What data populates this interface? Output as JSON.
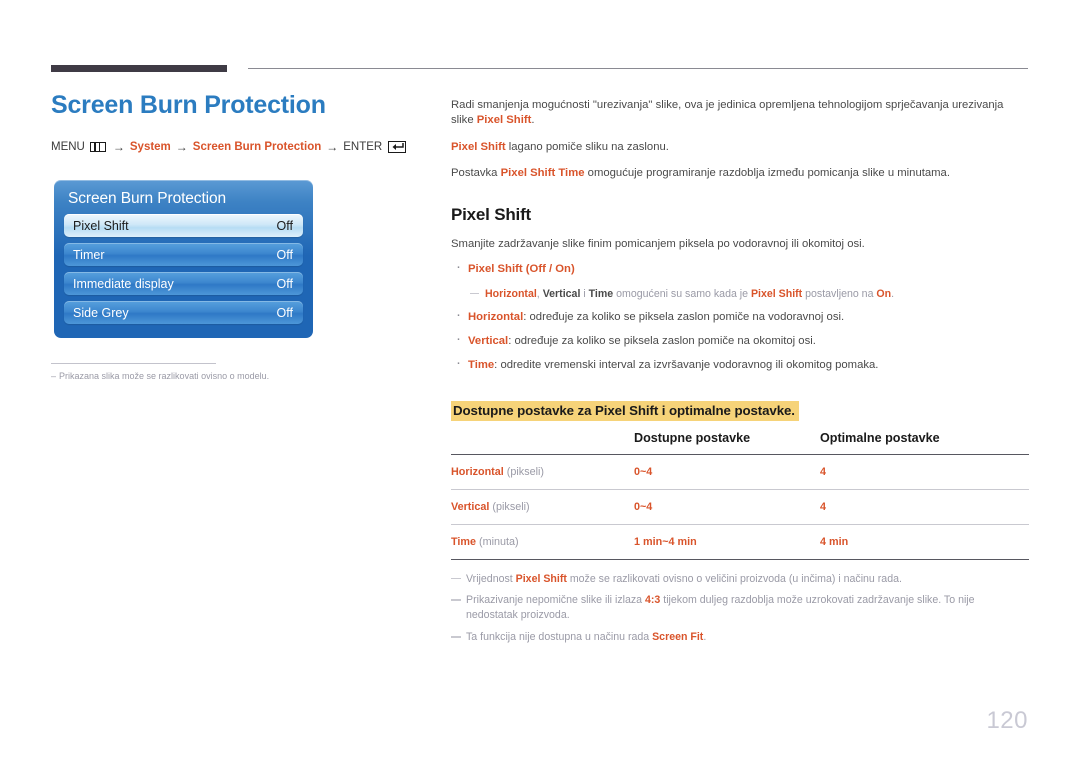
{
  "page_number": "120",
  "title": "Screen Burn Protection",
  "breadcrumb": {
    "menu_label": "MENU",
    "menu_icon": "menu-bars-icon",
    "arrow": "→",
    "item1": "System",
    "item2": "Screen Burn Protection",
    "enter_label": "ENTER",
    "enter_icon": "enter-return-icon"
  },
  "osd": {
    "title": "Screen Burn Protection",
    "rows": [
      {
        "label": "Pixel Shift",
        "value": "Off",
        "selected": true
      },
      {
        "label": "Timer",
        "value": "Off",
        "selected": false
      },
      {
        "label": "Immediate display",
        "value": "Off",
        "selected": false
      },
      {
        "label": "Side Grey",
        "value": "Off",
        "selected": false
      }
    ]
  },
  "left_note": {
    "dash": "–",
    "text": "Prikazana slika može se razlikovati ovisno o modelu."
  },
  "intro": {
    "p1_a": "Radi smanjenja mogućnosti \"urezivanja\" slike, ova je jedinica opremljena tehnologijom sprječavanja urezivanja slike ",
    "p1_b": "Pixel Shift",
    "p1_c": ".",
    "p2_a": "Pixel Shift",
    "p2_b": " lagano pomiče sliku na zaslonu.",
    "p3_a": "Postavka ",
    "p3_b": "Pixel Shift Time",
    "p3_c": " omogućuje programiranje razdoblja između pomicanja slike u minutama."
  },
  "section": {
    "heading": "Pixel Shift",
    "lead": "Smanjite zadržavanje slike finim pomicanjem piksela po vodoravnoj ili okomitoj osi.",
    "bullet1_a": "Pixel Shift",
    "bullet1_b": " (Off / On)",
    "subnote_a": "Horizontal",
    "subnote_b": ", ",
    "subnote_c": "Vertical",
    "subnote_d": " i ",
    "subnote_e": "Time",
    "subnote_f": " omogućeni su samo kada je ",
    "subnote_g": "Pixel Shift",
    "subnote_h": " postavljeno na ",
    "subnote_i": "On",
    "subnote_j": ".",
    "bullet2_a": "Horizontal",
    "bullet2_b": ": određuje za koliko se piksela zaslon pomiče na vodoravnoj osi.",
    "bullet3_a": "Vertical",
    "bullet3_b": ": određuje za koliko se piksela zaslon pomiče na okomitoj osi.",
    "bullet4_a": "Time",
    "bullet4_b": ": odredite vremenski interval za izvršavanje vodoravnog ili okomitog pomaka."
  },
  "table": {
    "caption": "Dostupne postavke za Pixel Shift i optimalne postavke.",
    "headers": [
      "",
      "Dostupne postavke",
      "Optimalne postavke"
    ],
    "rows": [
      {
        "name": "Horizontal",
        "unit": " (pikseli)",
        "available": "0~4",
        "optimal": "4"
      },
      {
        "name": "Vertical",
        "unit": " (pikseli)",
        "available": "0~4",
        "optimal": "4"
      },
      {
        "name": "Time",
        "unit": " (minuta)",
        "available": "1 min~4 min",
        "optimal": "4 min"
      }
    ]
  },
  "footnotes": {
    "f1_a": "Vrijednost ",
    "f1_b": "Pixel Shift",
    "f1_c": " može se razlikovati ovisno o veličini proizvoda (u inčima) i načinu rada.",
    "f2_a": "Prikazivanje nepomične slike ili izlaza ",
    "f2_b": "4:3",
    "f2_c": " tijekom duljeg razdoblja može uzrokovati zadržavanje slike. To nije nedostatak proizvoda.",
    "f3_a": "Ta funkcija nije dostupna u načinu rada ",
    "f3_b": "Screen Fit",
    "f3_c": "."
  },
  "colors": {
    "accent_orange": "#d9542b",
    "title_blue": "#2b7cc0",
    "highlight_yellow": "#f6d379",
    "osd_blue": "#1f66b5",
    "muted_gray": "#9a9aa6"
  }
}
